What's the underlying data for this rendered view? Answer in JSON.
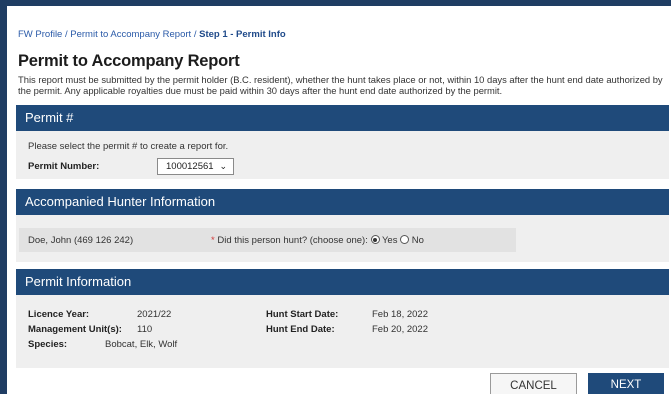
{
  "breadcrumb": {
    "link1": "FW Profile",
    "sep1": " / ",
    "link2": "Permit to Accompany Report",
    "sep2": " / ",
    "current": "Step 1 - Permit Info"
  },
  "page_title": "Permit to Accompany Report",
  "intro_text": "This report must be submitted by the permit holder (B.C. resident), whether the hunt takes place or not, within 10 days after the hunt end date authorized by the permit. Any applicable royalties due must be paid within 30 days after the hunt end date authorized by the permit.",
  "permit_section": {
    "title": "Permit #",
    "instruction": "Please select the permit # to create a report for.",
    "permit_number_label": "Permit Number:",
    "permit_number_value": "100012561"
  },
  "hunter_section": {
    "title": "Accompanied Hunter Information",
    "hunter_name": "Doe, John (469 126 242)",
    "question_required_mark": "*",
    "question": "Did this person hunt? (choose one):",
    "option_yes": "Yes",
    "option_no": "No",
    "selected": "Yes"
  },
  "permit_info_section": {
    "title": "Permit Information",
    "licence_year_label": "Licence Year:",
    "licence_year_value": "2021/22",
    "management_unit_label": "Management Unit(s):",
    "management_unit_value": "110",
    "species_label": "Species:",
    "species_value": "Bobcat, Elk, Wolf",
    "hunt_start_label": "Hunt Start Date:",
    "hunt_start_value": "Feb 18, 2022",
    "hunt_end_label": "Hunt End Date:",
    "hunt_end_value": "Feb 20, 2022"
  },
  "buttons": {
    "cancel": "CANCEL",
    "next": "NEXT"
  },
  "icons": {
    "select_chevron": "chevron-down-icon"
  },
  "colors": {
    "header_blue": "#1f4a7a",
    "link_blue": "#2a5aa8",
    "required_red": "#d23a3a"
  }
}
